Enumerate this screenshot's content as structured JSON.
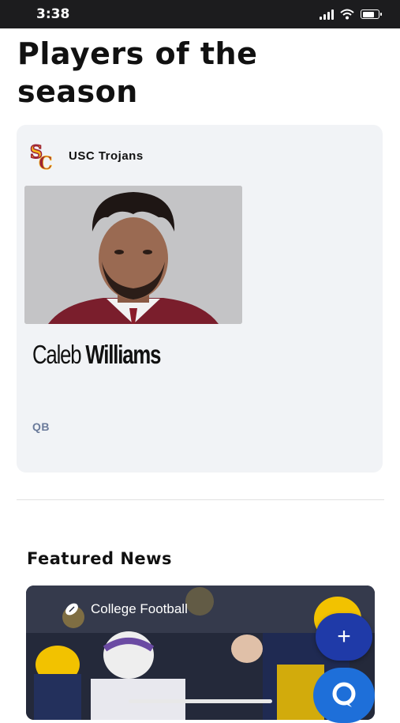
{
  "status_bar": {
    "time": "3:38"
  },
  "page": {
    "title": "Players of the season"
  },
  "player_card": {
    "team_name": "USC Trojans",
    "first_name": "Caleb",
    "last_name": "Williams",
    "position": "QB"
  },
  "featured_news": {
    "title": "Featured News",
    "card": {
      "category": "College Football"
    }
  },
  "fabs": {
    "add_label": "+"
  },
  "colors": {
    "accent_blue": "#1f3aa8",
    "chat_blue": "#1e6fd9",
    "usc_red": "#9d2235",
    "usc_gold": "#f5b81c",
    "position_gray_blue": "#6a7a9a"
  }
}
